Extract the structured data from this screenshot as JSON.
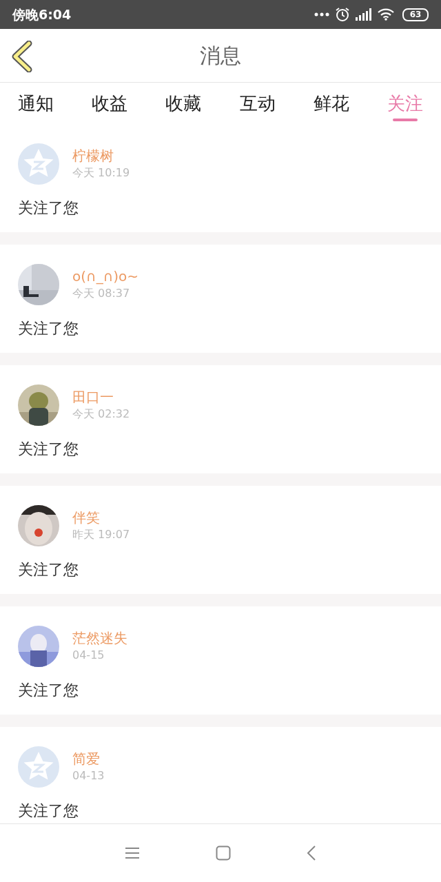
{
  "status_bar": {
    "time": "傍晚6:04",
    "battery": "63"
  },
  "header": {
    "title": "消息"
  },
  "tabs": [
    {
      "label": "通知",
      "selected": false
    },
    {
      "label": "收益",
      "selected": false
    },
    {
      "label": "收藏",
      "selected": false
    },
    {
      "label": "互动",
      "selected": false
    },
    {
      "label": "鲜花",
      "selected": false
    },
    {
      "label": "关注",
      "selected": true
    }
  ],
  "messages": [
    {
      "avatar": {
        "kind": "default"
      },
      "name": "柠檬树",
      "time": "今天 10:19",
      "text": "关注了您"
    },
    {
      "name": "o(∩_∩)o~",
      "time": "今天 08:37",
      "text": "关注了您"
    },
    {
      "name": "田口一",
      "time": "今天 02:32",
      "text": "关注了您"
    },
    {
      "name": "伴笑",
      "time": "昨天 19:07",
      "text": "关注了您"
    },
    {
      "name": "茫然迷失",
      "time": "04-15",
      "text": "关注了您"
    },
    {
      "avatar": {
        "kind": "default"
      },
      "name": "简爱",
      "time": "04-13",
      "text": "关注了您"
    }
  ]
}
